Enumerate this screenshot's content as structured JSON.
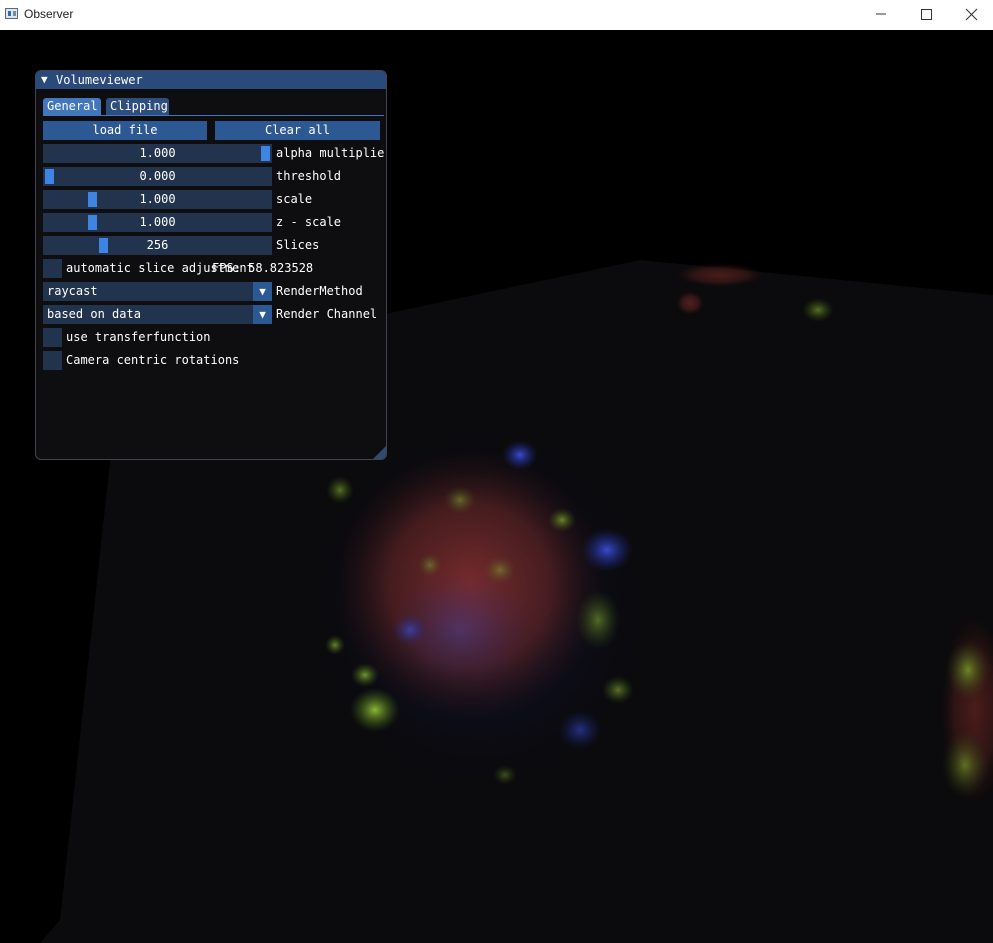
{
  "window": {
    "title": "Observer",
    "controls": {
      "minimize_icon": "minimize-icon",
      "maximize_icon": "maximize-icon",
      "close_icon": "close-icon"
    }
  },
  "panel": {
    "title": "Volumeviewer",
    "tabs": [
      {
        "label": "General",
        "active": true
      },
      {
        "label": "Clipping",
        "active": false
      }
    ],
    "buttons": {
      "load": "load file",
      "clear": "Clear all"
    },
    "sliders": [
      {
        "value_text": "1.000",
        "label": "alpha multiplier",
        "fraction": 1.0
      },
      {
        "value_text": "0.000",
        "label": "threshold",
        "fraction": 0.0
      },
      {
        "value_text": "1.000",
        "label": "scale",
        "fraction": 0.2
      },
      {
        "value_text": "1.000",
        "label": "z - scale",
        "fraction": 0.2
      },
      {
        "value_text": "256",
        "label": "Slices",
        "fraction": 0.25
      }
    ],
    "auto_slice": {
      "label": "automatic slice adjustment",
      "checked": false
    },
    "fps": "FPS: 58.823528",
    "combos": [
      {
        "value": "raycast",
        "label": "RenderMethod"
      },
      {
        "value": "based on data",
        "label": "Render Channel"
      }
    ],
    "checkboxes": [
      {
        "label": "use transferfunction",
        "checked": false
      },
      {
        "label": "Camera centric rotations",
        "checked": false
      }
    ]
  },
  "colors": {
    "title_bg": "#294a7a",
    "button_bg": "#2c5894",
    "frame_bg": "#22344d",
    "grab": "#3d85e0",
    "tab_active": "#4277bd",
    "window_bg": "#0f0f12"
  }
}
